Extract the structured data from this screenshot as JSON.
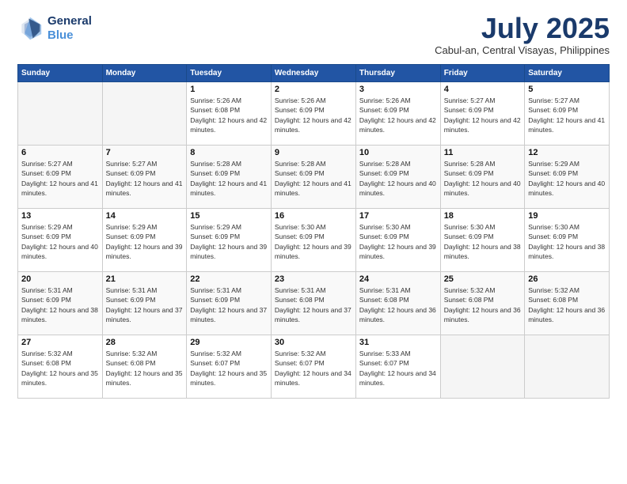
{
  "header": {
    "logo_line1": "General",
    "logo_line2": "Blue",
    "month": "July 2025",
    "location": "Cabul-an, Central Visayas, Philippines"
  },
  "weekdays": [
    "Sunday",
    "Monday",
    "Tuesday",
    "Wednesday",
    "Thursday",
    "Friday",
    "Saturday"
  ],
  "weeks": [
    [
      {
        "day": "",
        "info": ""
      },
      {
        "day": "",
        "info": ""
      },
      {
        "day": "1",
        "info": "Sunrise: 5:26 AM\nSunset: 6:08 PM\nDaylight: 12 hours and 42 minutes."
      },
      {
        "day": "2",
        "info": "Sunrise: 5:26 AM\nSunset: 6:09 PM\nDaylight: 12 hours and 42 minutes."
      },
      {
        "day": "3",
        "info": "Sunrise: 5:26 AM\nSunset: 6:09 PM\nDaylight: 12 hours and 42 minutes."
      },
      {
        "day": "4",
        "info": "Sunrise: 5:27 AM\nSunset: 6:09 PM\nDaylight: 12 hours and 42 minutes."
      },
      {
        "day": "5",
        "info": "Sunrise: 5:27 AM\nSunset: 6:09 PM\nDaylight: 12 hours and 41 minutes."
      }
    ],
    [
      {
        "day": "6",
        "info": "Sunrise: 5:27 AM\nSunset: 6:09 PM\nDaylight: 12 hours and 41 minutes."
      },
      {
        "day": "7",
        "info": "Sunrise: 5:27 AM\nSunset: 6:09 PM\nDaylight: 12 hours and 41 minutes."
      },
      {
        "day": "8",
        "info": "Sunrise: 5:28 AM\nSunset: 6:09 PM\nDaylight: 12 hours and 41 minutes."
      },
      {
        "day": "9",
        "info": "Sunrise: 5:28 AM\nSunset: 6:09 PM\nDaylight: 12 hours and 41 minutes."
      },
      {
        "day": "10",
        "info": "Sunrise: 5:28 AM\nSunset: 6:09 PM\nDaylight: 12 hours and 40 minutes."
      },
      {
        "day": "11",
        "info": "Sunrise: 5:28 AM\nSunset: 6:09 PM\nDaylight: 12 hours and 40 minutes."
      },
      {
        "day": "12",
        "info": "Sunrise: 5:29 AM\nSunset: 6:09 PM\nDaylight: 12 hours and 40 minutes."
      }
    ],
    [
      {
        "day": "13",
        "info": "Sunrise: 5:29 AM\nSunset: 6:09 PM\nDaylight: 12 hours and 40 minutes."
      },
      {
        "day": "14",
        "info": "Sunrise: 5:29 AM\nSunset: 6:09 PM\nDaylight: 12 hours and 39 minutes."
      },
      {
        "day": "15",
        "info": "Sunrise: 5:29 AM\nSunset: 6:09 PM\nDaylight: 12 hours and 39 minutes."
      },
      {
        "day": "16",
        "info": "Sunrise: 5:30 AM\nSunset: 6:09 PM\nDaylight: 12 hours and 39 minutes."
      },
      {
        "day": "17",
        "info": "Sunrise: 5:30 AM\nSunset: 6:09 PM\nDaylight: 12 hours and 39 minutes."
      },
      {
        "day": "18",
        "info": "Sunrise: 5:30 AM\nSunset: 6:09 PM\nDaylight: 12 hours and 38 minutes."
      },
      {
        "day": "19",
        "info": "Sunrise: 5:30 AM\nSunset: 6:09 PM\nDaylight: 12 hours and 38 minutes."
      }
    ],
    [
      {
        "day": "20",
        "info": "Sunrise: 5:31 AM\nSunset: 6:09 PM\nDaylight: 12 hours and 38 minutes."
      },
      {
        "day": "21",
        "info": "Sunrise: 5:31 AM\nSunset: 6:09 PM\nDaylight: 12 hours and 37 minutes."
      },
      {
        "day": "22",
        "info": "Sunrise: 5:31 AM\nSunset: 6:09 PM\nDaylight: 12 hours and 37 minutes."
      },
      {
        "day": "23",
        "info": "Sunrise: 5:31 AM\nSunset: 6:08 PM\nDaylight: 12 hours and 37 minutes."
      },
      {
        "day": "24",
        "info": "Sunrise: 5:31 AM\nSunset: 6:08 PM\nDaylight: 12 hours and 36 minutes."
      },
      {
        "day": "25",
        "info": "Sunrise: 5:32 AM\nSunset: 6:08 PM\nDaylight: 12 hours and 36 minutes."
      },
      {
        "day": "26",
        "info": "Sunrise: 5:32 AM\nSunset: 6:08 PM\nDaylight: 12 hours and 36 minutes."
      }
    ],
    [
      {
        "day": "27",
        "info": "Sunrise: 5:32 AM\nSunset: 6:08 PM\nDaylight: 12 hours and 35 minutes."
      },
      {
        "day": "28",
        "info": "Sunrise: 5:32 AM\nSunset: 6:08 PM\nDaylight: 12 hours and 35 minutes."
      },
      {
        "day": "29",
        "info": "Sunrise: 5:32 AM\nSunset: 6:07 PM\nDaylight: 12 hours and 35 minutes."
      },
      {
        "day": "30",
        "info": "Sunrise: 5:32 AM\nSunset: 6:07 PM\nDaylight: 12 hours and 34 minutes."
      },
      {
        "day": "31",
        "info": "Sunrise: 5:33 AM\nSunset: 6:07 PM\nDaylight: 12 hours and 34 minutes."
      },
      {
        "day": "",
        "info": ""
      },
      {
        "day": "",
        "info": ""
      }
    ]
  ]
}
